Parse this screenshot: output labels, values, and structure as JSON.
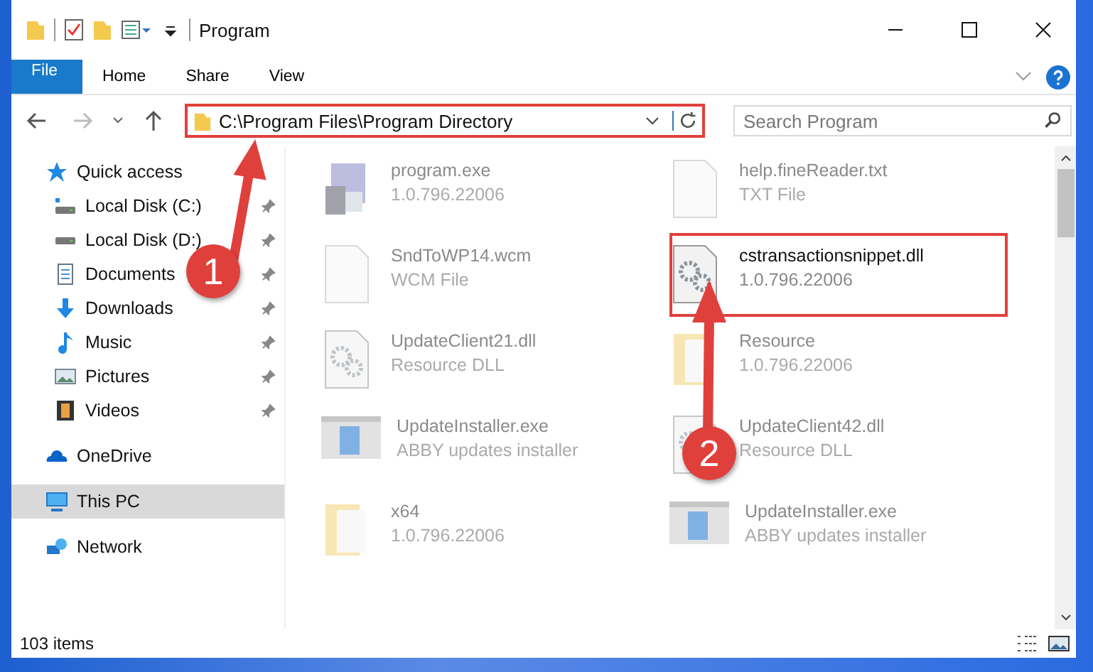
{
  "window": {
    "title": "Program"
  },
  "ribbon_tabs": [
    {
      "label": "File",
      "kind": "file",
      "selected": false
    },
    {
      "label": "Home",
      "kind": "tab",
      "selected": false
    },
    {
      "label": "Share",
      "kind": "tab",
      "selected": false
    },
    {
      "label": "View",
      "kind": "tab",
      "selected": false
    }
  ],
  "address": {
    "path": "C:\\Program Files\\Program Directory"
  },
  "search": {
    "placeholder": "Search Program"
  },
  "sidebar": {
    "items": [
      {
        "label": "Quick access",
        "kind": "quick",
        "selected": false,
        "children": [
          {
            "label": "Local Disk (C:)",
            "kind": "disk-c",
            "pinned": true,
            "selected": false
          },
          {
            "label": "Local Disk (D:)",
            "kind": "disk",
            "pinned": true,
            "selected": false
          },
          {
            "label": "Documents",
            "kind": "documents",
            "pinned": true,
            "selected": false
          },
          {
            "label": "Downloads",
            "kind": "downloads",
            "pinned": true,
            "selected": false
          },
          {
            "label": "Music",
            "kind": "music",
            "pinned": true,
            "selected": false
          },
          {
            "label": "Pictures",
            "kind": "pictures",
            "pinned": true,
            "selected": false
          },
          {
            "label": "Videos",
            "kind": "videos",
            "pinned": true,
            "selected": false
          }
        ]
      },
      {
        "label": "OneDrive",
        "kind": "cloud",
        "selected": false
      },
      {
        "label": "This PC",
        "kind": "pc",
        "selected": true
      },
      {
        "label": "Network",
        "kind": "network",
        "selected": false
      }
    ]
  },
  "files": [
    {
      "name": "program.exe",
      "detail": "1.0.796.22006",
      "kind": "exe",
      "blurred": true
    },
    {
      "name": "help.fineReader.txt",
      "detail": "TXT File",
      "kind": "doc",
      "blurred": true
    },
    {
      "name": "SndToWP14.wcm",
      "detail": "WCM File",
      "kind": "doc",
      "blurred": true
    },
    {
      "name": "cstransactionsnippet.dll",
      "detail": "1.0.796.22006",
      "kind": "dll",
      "blurred": false
    },
    {
      "name": "UpdateClient21.dll",
      "detail": "Resource DLL",
      "kind": "dll",
      "blurred": true
    },
    {
      "name": "Resource",
      "detail": "1.0.796.22006",
      "kind": "folder",
      "blurred": true
    },
    {
      "name": "UpdateInstaller.exe",
      "detail": "ABBY updates installer",
      "kind": "installer",
      "blurred": true
    },
    {
      "name": "UpdateClient42.dll",
      "detail": "Resource DLL",
      "kind": "dll",
      "blurred": true
    },
    {
      "name": "x64",
      "detail": "1.0.796.22006",
      "kind": "folder",
      "blurred": true
    },
    {
      "name": "UpdateInstaller.exe",
      "detail": "ABBY updates installer",
      "kind": "installer",
      "blurred": true
    }
  ],
  "annotations": [
    {
      "label": "1"
    },
    {
      "label": "2"
    }
  ],
  "status_bar": {
    "count": "103 items"
  }
}
